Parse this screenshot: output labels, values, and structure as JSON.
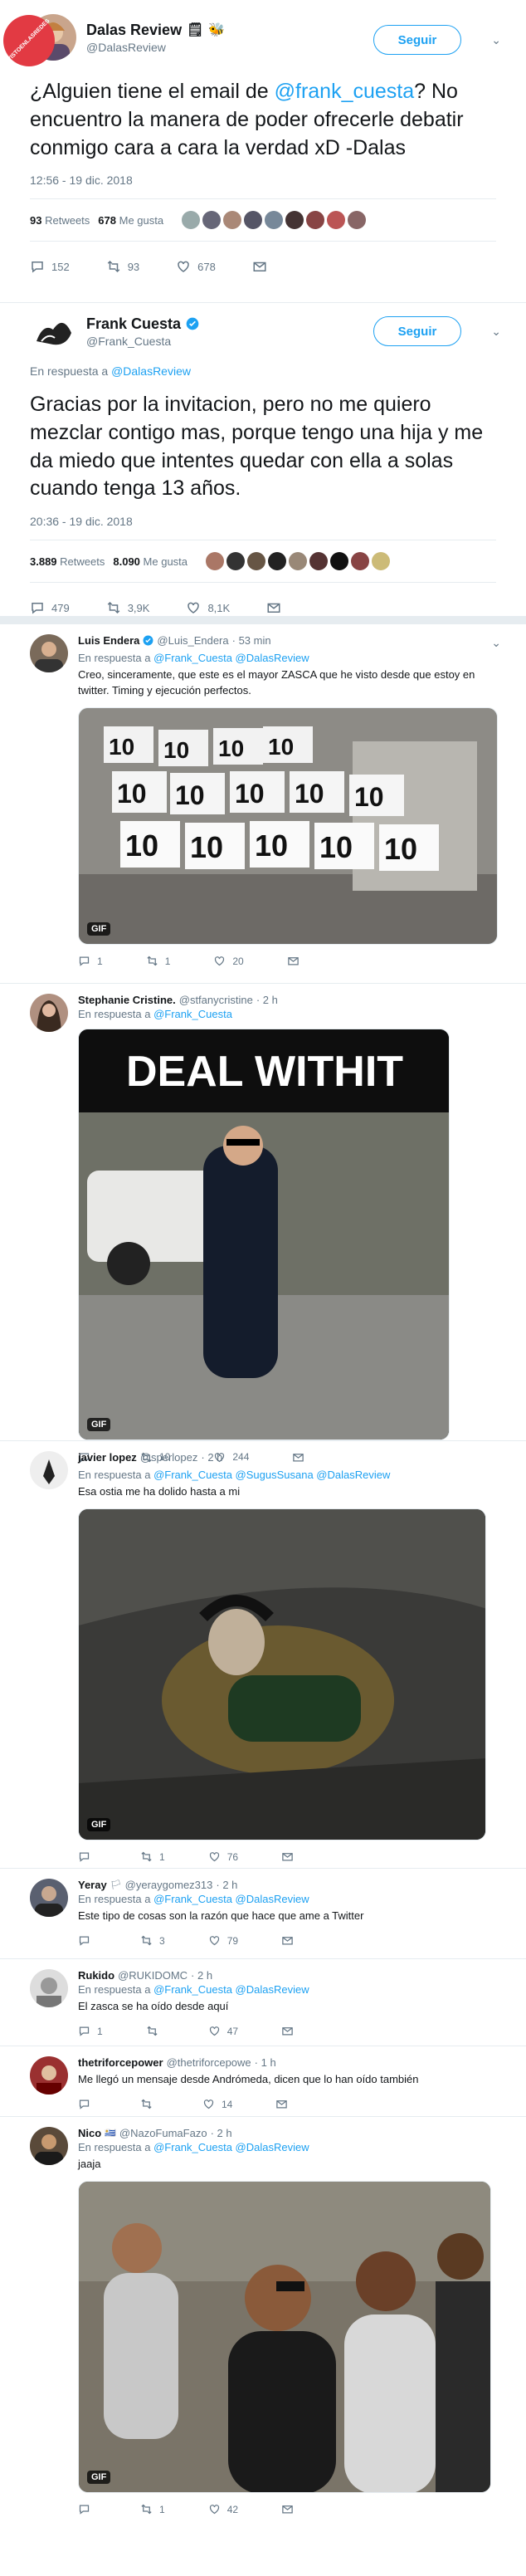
{
  "watermark": {
    "text": "VISTOENLASREDES"
  },
  "tweet1": {
    "name": "Dalas Review",
    "handle": "@DalasReview",
    "follow_label": "Seguir",
    "text_before": "¿Alguien tiene el email de ",
    "mention": "@frank_cuesta",
    "text_after": "? No encuentro la manera de poder ofrecerle debatir conmigo cara a cara la verdad xD -Dalas",
    "time": "12:56 - 19 dic. 2018",
    "retweets_count": "93",
    "retweets_label": "Retweets",
    "likes_count": "678",
    "likes_label": "Me gusta",
    "reply_count": "152",
    "retweet_count": "93",
    "like_count": "678"
  },
  "tweet2": {
    "name": "Frank Cuesta",
    "handle": "@Frank_Cuesta",
    "follow_label": "Seguir",
    "reply_prefix": "En respuesta a",
    "reply_mention": "@DalasReview",
    "text": "Gracias por la invitacion, pero no me quiero mezclar contigo mas, porque tengo una hija y me da miedo que intentes quedar con ella a solas cuando tenga 13 años.",
    "time": "20:36 - 19 dic. 2018",
    "retweets_count": "3.889",
    "retweets_label": "Retweets",
    "likes_count": "8.090",
    "likes_label": "Me gusta",
    "reply_count": "479",
    "retweet_count": "3,9K",
    "like_count": "8,1K"
  },
  "replies": [
    {
      "name": "Luis Endera",
      "handle": "@Luis_Endera",
      "time": "· 53 min",
      "reply_prefix": "En respuesta a",
      "mentions": "@Frank_Cuesta @DalasReview",
      "text": "Creo, sinceramente, que este es el mayor ZASCA que he visto desde que estoy en twitter. Timing y ejecución perfectos.",
      "gif_label": "GIF",
      "media_text": "10",
      "reply_count": "1",
      "retweet_count": "1",
      "like_count": "20"
    },
    {
      "name": "Stephanie Cristine.",
      "handle": "@stfanycristine",
      "time": "· 2 h",
      "reply_prefix": "En respuesta a",
      "mentions": "@Frank_Cuesta",
      "text": "",
      "gif_label": "GIF",
      "media_text": "DEAL WITHIT",
      "reply_count": "",
      "retweet_count": "10",
      "like_count": "244"
    },
    {
      "name": "javier lopez",
      "handle": "@sperlopez",
      "time": "· 2 h",
      "reply_prefix": "En respuesta a",
      "mentions": "@Frank_Cuesta @SugusSusana @DalasReview",
      "text": "Esa ostia me ha dolido hasta a mi",
      "gif_label": "GIF",
      "reply_count": "",
      "retweet_count": "1",
      "like_count": "76"
    },
    {
      "name": "Yeray",
      "handle": "@yeraygomez313",
      "time": "· 2 h",
      "reply_prefix": "En respuesta a",
      "mentions": "@Frank_Cuesta @DalasReview",
      "text": "Este tipo de cosas son la razón que hace que ame a Twitter",
      "reply_count": "",
      "retweet_count": "3",
      "like_count": "79"
    },
    {
      "name": "Rukido",
      "handle": "@RUKIDOMC",
      "time": "· 2 h",
      "reply_prefix": "En respuesta a",
      "mentions": "@Frank_Cuesta @DalasReview",
      "text": "El zasca se ha oído desde aquí",
      "reply_count": "1",
      "retweet_count": "",
      "like_count": "47"
    },
    {
      "name": "thetriforcepower",
      "handle": "@thetriforcepowe",
      "time": "· 1 h",
      "text": "Me llegó un mensaje desde Andrómeda, dicen que lo han oído también",
      "reply_count": "",
      "retweet_count": "",
      "like_count": "14"
    },
    {
      "name": "Nico",
      "handle": "@NazoFumaFazo",
      "time": "· 2 h",
      "reply_prefix": "En respuesta a",
      "mentions": "@Frank_Cuesta @DalasReview",
      "text": "jaaja",
      "gif_label": "GIF",
      "reply_count": "",
      "retweet_count": "1",
      "like_count": "42"
    }
  ],
  "colors": {
    "accent": "#1da1f2",
    "muted": "#657786",
    "text": "#14171a",
    "separator": "#e6ecf0"
  }
}
